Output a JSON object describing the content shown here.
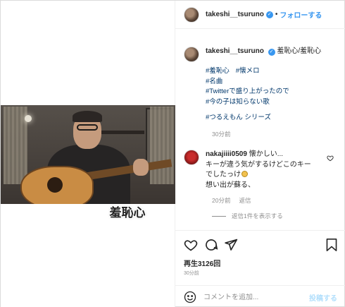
{
  "header": {
    "username": "takeshi__tsuruno",
    "separator": "•",
    "follow_label": "フォローする"
  },
  "video": {
    "overlay_caption": "羞恥心"
  },
  "caption": {
    "username": "takeshi__tsuruno",
    "text": "羞恥心/羞恥心",
    "hashtags_line1": [
      "#羞恥心",
      "#懐メロ"
    ],
    "hashtags": [
      "#名曲",
      "#Twitterで盛り上がったので",
      "#今の子は知らない歌"
    ],
    "series_tag": "#つるえもん シリーズ",
    "time": "30分前"
  },
  "comment": {
    "username": "nakajiiii0509",
    "line1": "懐かしい...",
    "line2": "キーが違う気がするけどこのキー",
    "line3": "でしたっけ",
    "line4": "想い出が蘇る、",
    "time": "20分前",
    "reply_label": "返信",
    "view_replies_label": "返信1件を表示する"
  },
  "stats": {
    "views": "再生3126回",
    "posted": "30分前"
  },
  "comment_box": {
    "placeholder": "コメントを追加...",
    "post_label": "投稿する"
  },
  "icons": {
    "verified": "verified-badge-icon",
    "heart": "heart-icon",
    "comment": "comment-bubble-icon",
    "share": "paper-plane-icon",
    "save": "bookmark-icon",
    "emoji": "smiley-face-icon"
  },
  "colors": {
    "link_blue": "#3897f0",
    "hashtag": "#00376b",
    "muted": "#8e8e8e",
    "post_disabled": "#b2dffc"
  }
}
